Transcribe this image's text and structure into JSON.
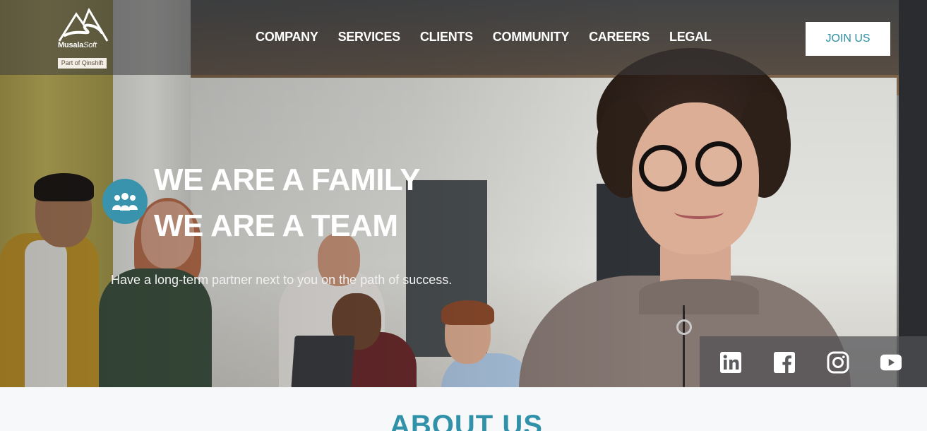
{
  "brand": {
    "name_bold": "Musala",
    "name_italic": "Soft",
    "tagline": "Part of Qinshift"
  },
  "nav": {
    "items": [
      "COMPANY",
      "SERVICES",
      "CLIENTS",
      "COMMUNITY",
      "CAREERS",
      "LEGAL"
    ],
    "join_label": "JOIN US"
  },
  "hero": {
    "headline_1": "WE ARE A FAMILY",
    "headline_2": "WE ARE A TEAM",
    "subline": "Have a long-term partner next to you on the path of success.",
    "badge_icon": "team-icon"
  },
  "social": {
    "icons": [
      "linkedin-icon",
      "facebook-icon",
      "instagram-icon",
      "youtube-icon"
    ]
  },
  "about": {
    "title": "ABOUT US"
  },
  "colors": {
    "accent": "#3091a9",
    "badge": "#3a93ad",
    "button_text": "#2d8fa5",
    "page_bg": "#f6f8fa"
  }
}
